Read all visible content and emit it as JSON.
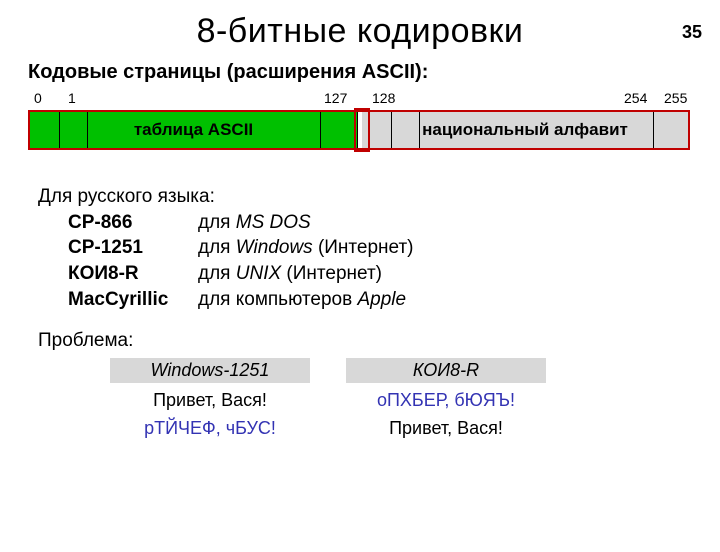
{
  "page_number": "35",
  "title": "8-битные кодировки",
  "subtitle": "Кодовые страницы (расширения ASCII):",
  "bar": {
    "labels": {
      "n0": "0",
      "n1": "1",
      "n127": "127",
      "n128": "128",
      "n254": "254",
      "n255": "255"
    },
    "left_caption": "таблица ASCII",
    "right_caption": "национальный алфавит"
  },
  "lang_intro": "Для русского языка:",
  "encodings": [
    {
      "name": "CP-866",
      "desc_pre": "для ",
      "desc_em": "MS DOS",
      "desc_post": ""
    },
    {
      "name": "CP-1251",
      "desc_pre": "для ",
      "desc_em": "Windows",
      "desc_post": " (Интернет)"
    },
    {
      "name": "КОИ8-R",
      "desc_pre": "для ",
      "desc_em": "UNIX",
      "desc_post": " (Интернет)"
    },
    {
      "name": "MacCyrillic",
      "desc_pre": "для компьютеров ",
      "desc_em": "Apple",
      "desc_post": ""
    }
  ],
  "problem_heading": "Проблема:",
  "columns": {
    "win": "Windows-1251",
    "koi": "КОИ8-R"
  },
  "cells": {
    "r1c1": "Привет, Вася!",
    "r1c2": "оПХБЕР, бЮЯЪ!",
    "r2c1": "рТЙЧЕФ, чБУС!",
    "r2c2": "Привет, Вася!"
  }
}
